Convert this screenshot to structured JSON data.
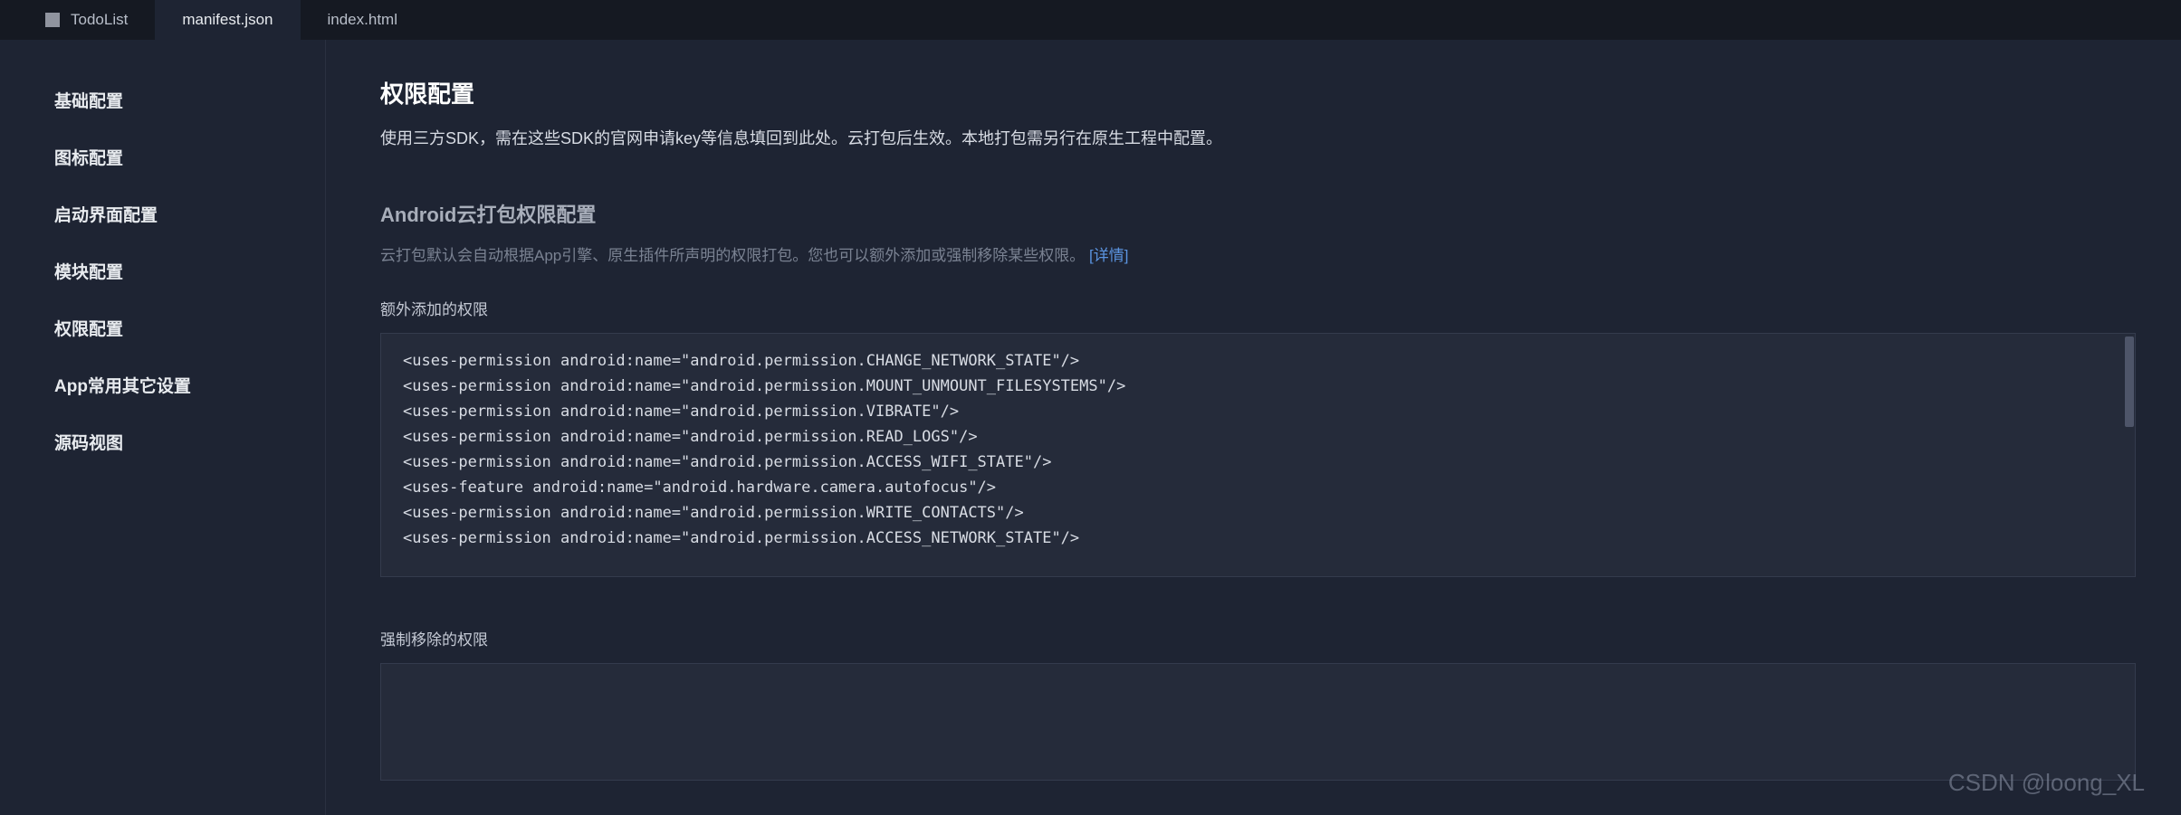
{
  "tabs": [
    {
      "label": "TodoList"
    },
    {
      "label": "manifest.json"
    },
    {
      "label": "index.html"
    }
  ],
  "sidebar": {
    "items": [
      {
        "label": "基础配置"
      },
      {
        "label": "图标配置"
      },
      {
        "label": "启动界面配置"
      },
      {
        "label": "模块配置"
      },
      {
        "label": "权限配置"
      },
      {
        "label": "App常用其它设置"
      },
      {
        "label": "源码视图"
      }
    ]
  },
  "page": {
    "title": "权限配置",
    "description": "使用三方SDK，需在这些SDK的官网申请key等信息填回到此处。云打包后生效。本地打包需另行在原生工程中配置。"
  },
  "section": {
    "title": "Android云打包权限配置",
    "description_prefix": "云打包默认会自动根据App引擎、原生插件所声明的权限打包。您也可以额外添加或强制移除某些权限。",
    "link_text": "[详情]"
  },
  "fields": {
    "extra_permissions": {
      "label": "额外添加的权限",
      "value": "<uses-permission android:name=\"android.permission.CHANGE_NETWORK_STATE\"/>\n<uses-permission android:name=\"android.permission.MOUNT_UNMOUNT_FILESYSTEMS\"/>\n<uses-permission android:name=\"android.permission.VIBRATE\"/>\n<uses-permission android:name=\"android.permission.READ_LOGS\"/>\n<uses-permission android:name=\"android.permission.ACCESS_WIFI_STATE\"/>\n<uses-feature android:name=\"android.hardware.camera.autofocus\"/>\n<uses-permission android:name=\"android.permission.WRITE_CONTACTS\"/>\n<uses-permission android:name=\"android.permission.ACCESS_NETWORK_STATE\"/>"
    },
    "removed_permissions": {
      "label": "强制移除的权限",
      "value": ""
    }
  },
  "watermark": "CSDN @loong_XL"
}
